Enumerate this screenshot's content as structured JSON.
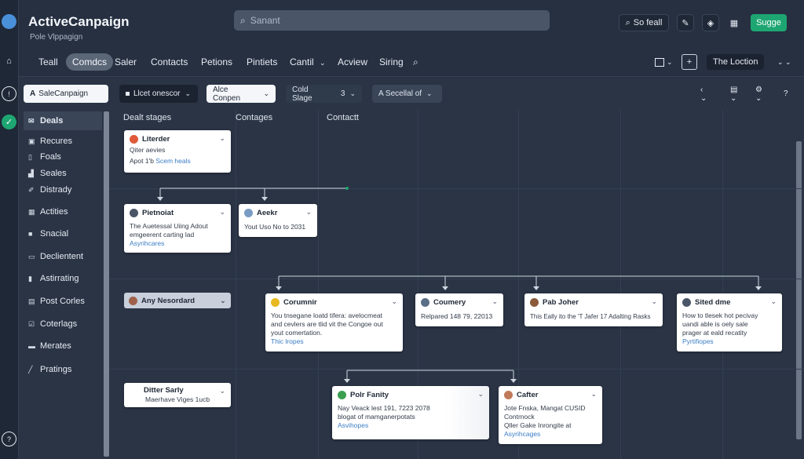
{
  "app": {
    "title": "ActiveCanpaign",
    "subtitle": "Pole Vlppagign"
  },
  "search": {
    "placeholder": "Sanant"
  },
  "header": {
    "so_feall": "So feall",
    "signup": "Sugge"
  },
  "nav": {
    "tabs": [
      "Teall",
      "Comdcs",
      "Saler",
      "Contacts",
      "Petions",
      "Pintiets",
      "Cantil",
      "Acview",
      "Siring"
    ],
    "active_tab": "Comdcs",
    "location_button": "The Loction"
  },
  "filters": {
    "campaign": "SaleCanpaign",
    "dark_filter": "Llcet onescor",
    "owner": "Alce Conpen",
    "stage": "Cold Slage",
    "stage_count": "3",
    "selected": "A Secellal of"
  },
  "sidebar": {
    "items": [
      {
        "label": "Deals",
        "icon": "mail-icon",
        "active": true
      },
      {
        "label": "Recures",
        "icon": "inbox-icon"
      },
      {
        "label": "Foals",
        "icon": "doc-icon"
      },
      {
        "label": "Seales",
        "icon": "bar-chart-icon"
      },
      {
        "label": "Distrady",
        "icon": "pen-icon"
      },
      {
        "label": "Actities",
        "icon": "grid-icon"
      },
      {
        "label": "Snacial",
        "icon": "square-icon"
      },
      {
        "label": "Declientent",
        "icon": "calendar-icon"
      },
      {
        "label": "Astirrating",
        "icon": "file-icon"
      },
      {
        "label": "Post Corles",
        "icon": "clipboard-icon"
      },
      {
        "label": "Coterlags",
        "icon": "check-box-icon"
      },
      {
        "label": "Merates",
        "icon": "message-icon"
      },
      {
        "label": "Pratings",
        "icon": "pencil-icon"
      }
    ]
  },
  "board": {
    "columns": [
      "Dealt stages",
      "Contages",
      "Contactt"
    ],
    "cards": {
      "c1": {
        "title": "Literder",
        "lines": [
          "Qiter aevies"
        ],
        "prefix": "Apot 1'b",
        "link": "Scem heals"
      },
      "c2": {
        "title": "Pietnoiat",
        "lines": [
          "The Auetessal Uiing Adout",
          "emgeerent carting lad"
        ],
        "link": "Asyrihcares"
      },
      "c3": {
        "title": "Aeekr",
        "lines": [
          "Yout Uso No to 2031"
        ]
      },
      "c4": {
        "title": "Any Nesordard"
      },
      "c5": {
        "title": "Corumnir",
        "lines": [
          "You tnsegane loatd tifera: avelocmeat",
          "and cevlers are tlid vit the Congoe out",
          "yout comertation."
        ],
        "link": "Thic lropes"
      },
      "c6": {
        "title": "Coumery",
        "lines": [
          "Relpared 148 79, 22013"
        ]
      },
      "c7": {
        "title": "Pab Joher",
        "lines": [
          "This Eally ito the 'T Jafer 17 Adalting Rasks"
        ]
      },
      "c8": {
        "title": "Sited dme",
        "lines": [
          "How to tlesek hot pecivay",
          "uandi able is oely sale",
          "prager at eald recatity"
        ],
        "link": "Pyrtifiopes"
      },
      "c9": {
        "title": "Ditter Sarly",
        "lines": [
          "Maerhave Viges 1ucb"
        ]
      },
      "c10": {
        "title": "Polr Fanity",
        "lines": [
          "Nay Veack lest 191, 7223 2078",
          "blogat of mamganerpotats"
        ],
        "link": "Asvihopes"
      },
      "c11": {
        "title": "Cafter",
        "lines": [
          "Jote Fnska, Mangat CUSID",
          "Contrnock",
          "Qller Gake Inrongite at"
        ],
        "link": "Asyrihcages"
      }
    }
  },
  "colors": {
    "accent_green": "#1ea672",
    "link_blue": "#3b7dc4",
    "bg": "#2a3445"
  }
}
